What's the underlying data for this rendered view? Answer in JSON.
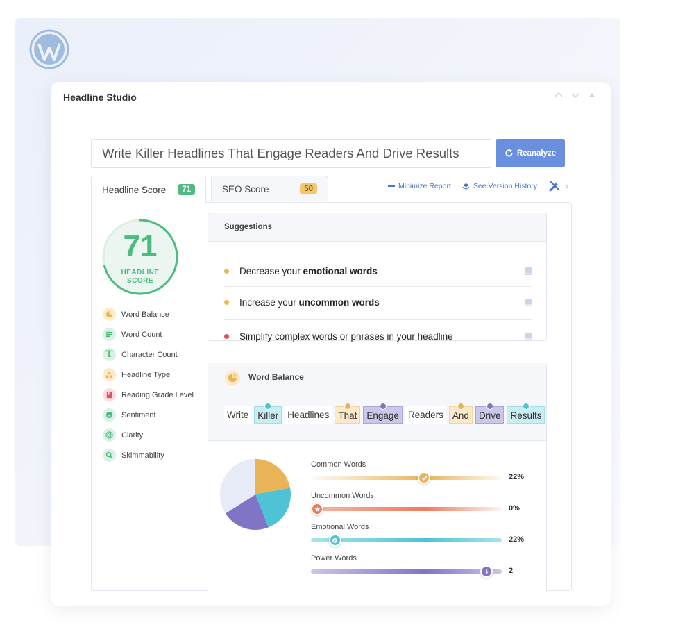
{
  "app": {
    "title": "Headline Studio"
  },
  "headline": {
    "value": "Write Killer Headlines That Engage Readers And Drive Results"
  },
  "reanalyze_label": "Reanalyze",
  "tabs": [
    {
      "label": "Headline Score",
      "score": "71"
    },
    {
      "label": "SEO Score",
      "score": "50"
    }
  ],
  "report_links": {
    "minimize": "Minimize Report",
    "history": "See Version History"
  },
  "gauge": {
    "score": "71",
    "label_line1": "HEADLINE",
    "label_line2": "SCORE",
    "fraction": 0.71,
    "color": "#4cbb7f"
  },
  "metrics": [
    {
      "label": "Word Balance",
      "icon": "pie-chart-icon"
    },
    {
      "label": "Word Count",
      "icon": "lines-icon"
    },
    {
      "label": "Character Count",
      "icon": "letter-t-icon"
    },
    {
      "label": "Headline Type",
      "icon": "shapes-icon"
    },
    {
      "label": "Reading Grade Level",
      "icon": "book-icon"
    },
    {
      "label": "Sentiment",
      "icon": "smile-icon"
    },
    {
      "label": "Clarity",
      "icon": "target-icon"
    },
    {
      "label": "Skimmability",
      "icon": "magnifier-icon"
    }
  ],
  "suggestions": {
    "title": "Suggestions",
    "items": [
      {
        "prefix": "Decrease your ",
        "bold": "emotional words",
        "status": "warning",
        "color": "#f0b64e"
      },
      {
        "prefix": "Increase your ",
        "bold": "uncommon words",
        "status": "warning",
        "color": "#f0b64e"
      },
      {
        "prefix": "Simplify complex words or phrases in your headline",
        "bold": "",
        "status": "error",
        "color": "#e34f5a"
      }
    ]
  },
  "word_balance": {
    "title": "Word Balance",
    "words": [
      {
        "text": "Write",
        "type": "none"
      },
      {
        "text": "Killer",
        "type": "emotional"
      },
      {
        "text": "Headlines",
        "type": "none"
      },
      {
        "text": "That",
        "type": "common"
      },
      {
        "text": "Engage",
        "type": "power"
      },
      {
        "text": "Readers",
        "type": "none"
      },
      {
        "text": "And",
        "type": "common"
      },
      {
        "text": "Drive",
        "type": "power"
      },
      {
        "text": "Results",
        "type": "emotional"
      }
    ],
    "categories": [
      {
        "label": "Common Words",
        "value": "22%",
        "level": 0.6,
        "color": "#e9b458",
        "icon": "check-icon"
      },
      {
        "label": "Uncommon Words",
        "value": "0%",
        "level": 0.0,
        "color": "#ef7a5c",
        "icon": "star-icon"
      },
      {
        "label": "Emotional Words",
        "value": "22%",
        "level": 0.1,
        "color": "#4ec3d6",
        "icon": "emotion-icon"
      },
      {
        "label": "Power Words",
        "value": "2",
        "level": 0.95,
        "color": "#7f74c6",
        "icon": "lightning-icon"
      }
    ]
  },
  "chart_data": {
    "type": "pie",
    "slices": [
      {
        "name": "Common Words",
        "value": 22,
        "color": "#e9b458"
      },
      {
        "name": "Emotional Words",
        "value": 22,
        "color": "#4ec3d6"
      },
      {
        "name": "Power Words",
        "value": 22,
        "color": "#7f74c6"
      },
      {
        "name": "Other",
        "value": 34,
        "color": "#e6ebf7"
      }
    ]
  }
}
